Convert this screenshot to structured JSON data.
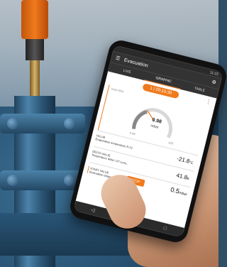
{
  "app": {
    "status_time": "11:15",
    "title": "Evacuation",
    "tabs": [
      {
        "label": "LIVE"
      },
      {
        "label": "GRAPHIC"
      },
      {
        "label": "TABLE"
      }
    ],
    "timer": "1 | 00:10:30",
    "gauge": {
      "tag": "testo 550i",
      "value": "0.98",
      "unit": "mbar",
      "min": "0.40",
      "max": "100"
    },
    "rows": [
      {
        "label1": "VALUE",
        "label2": "Evaporation temperature R-22",
        "value": "-21.8",
        "unit": "°C"
      },
      {
        "label1": "DELTA VALUE",
        "label2": "Temperature delta / ΔT curre...",
        "value": "41.8",
        "unit": "K"
      }
    ],
    "start_row": {
      "label1": "START VALUE",
      "label2": "Evacuation target",
      "button": "STOP",
      "value": "0.5",
      "unit": "mbar"
    },
    "nav": [
      "◁",
      "○",
      "□"
    ]
  },
  "colors": {
    "accent": "#f07a1c",
    "appbar": "#333333"
  }
}
